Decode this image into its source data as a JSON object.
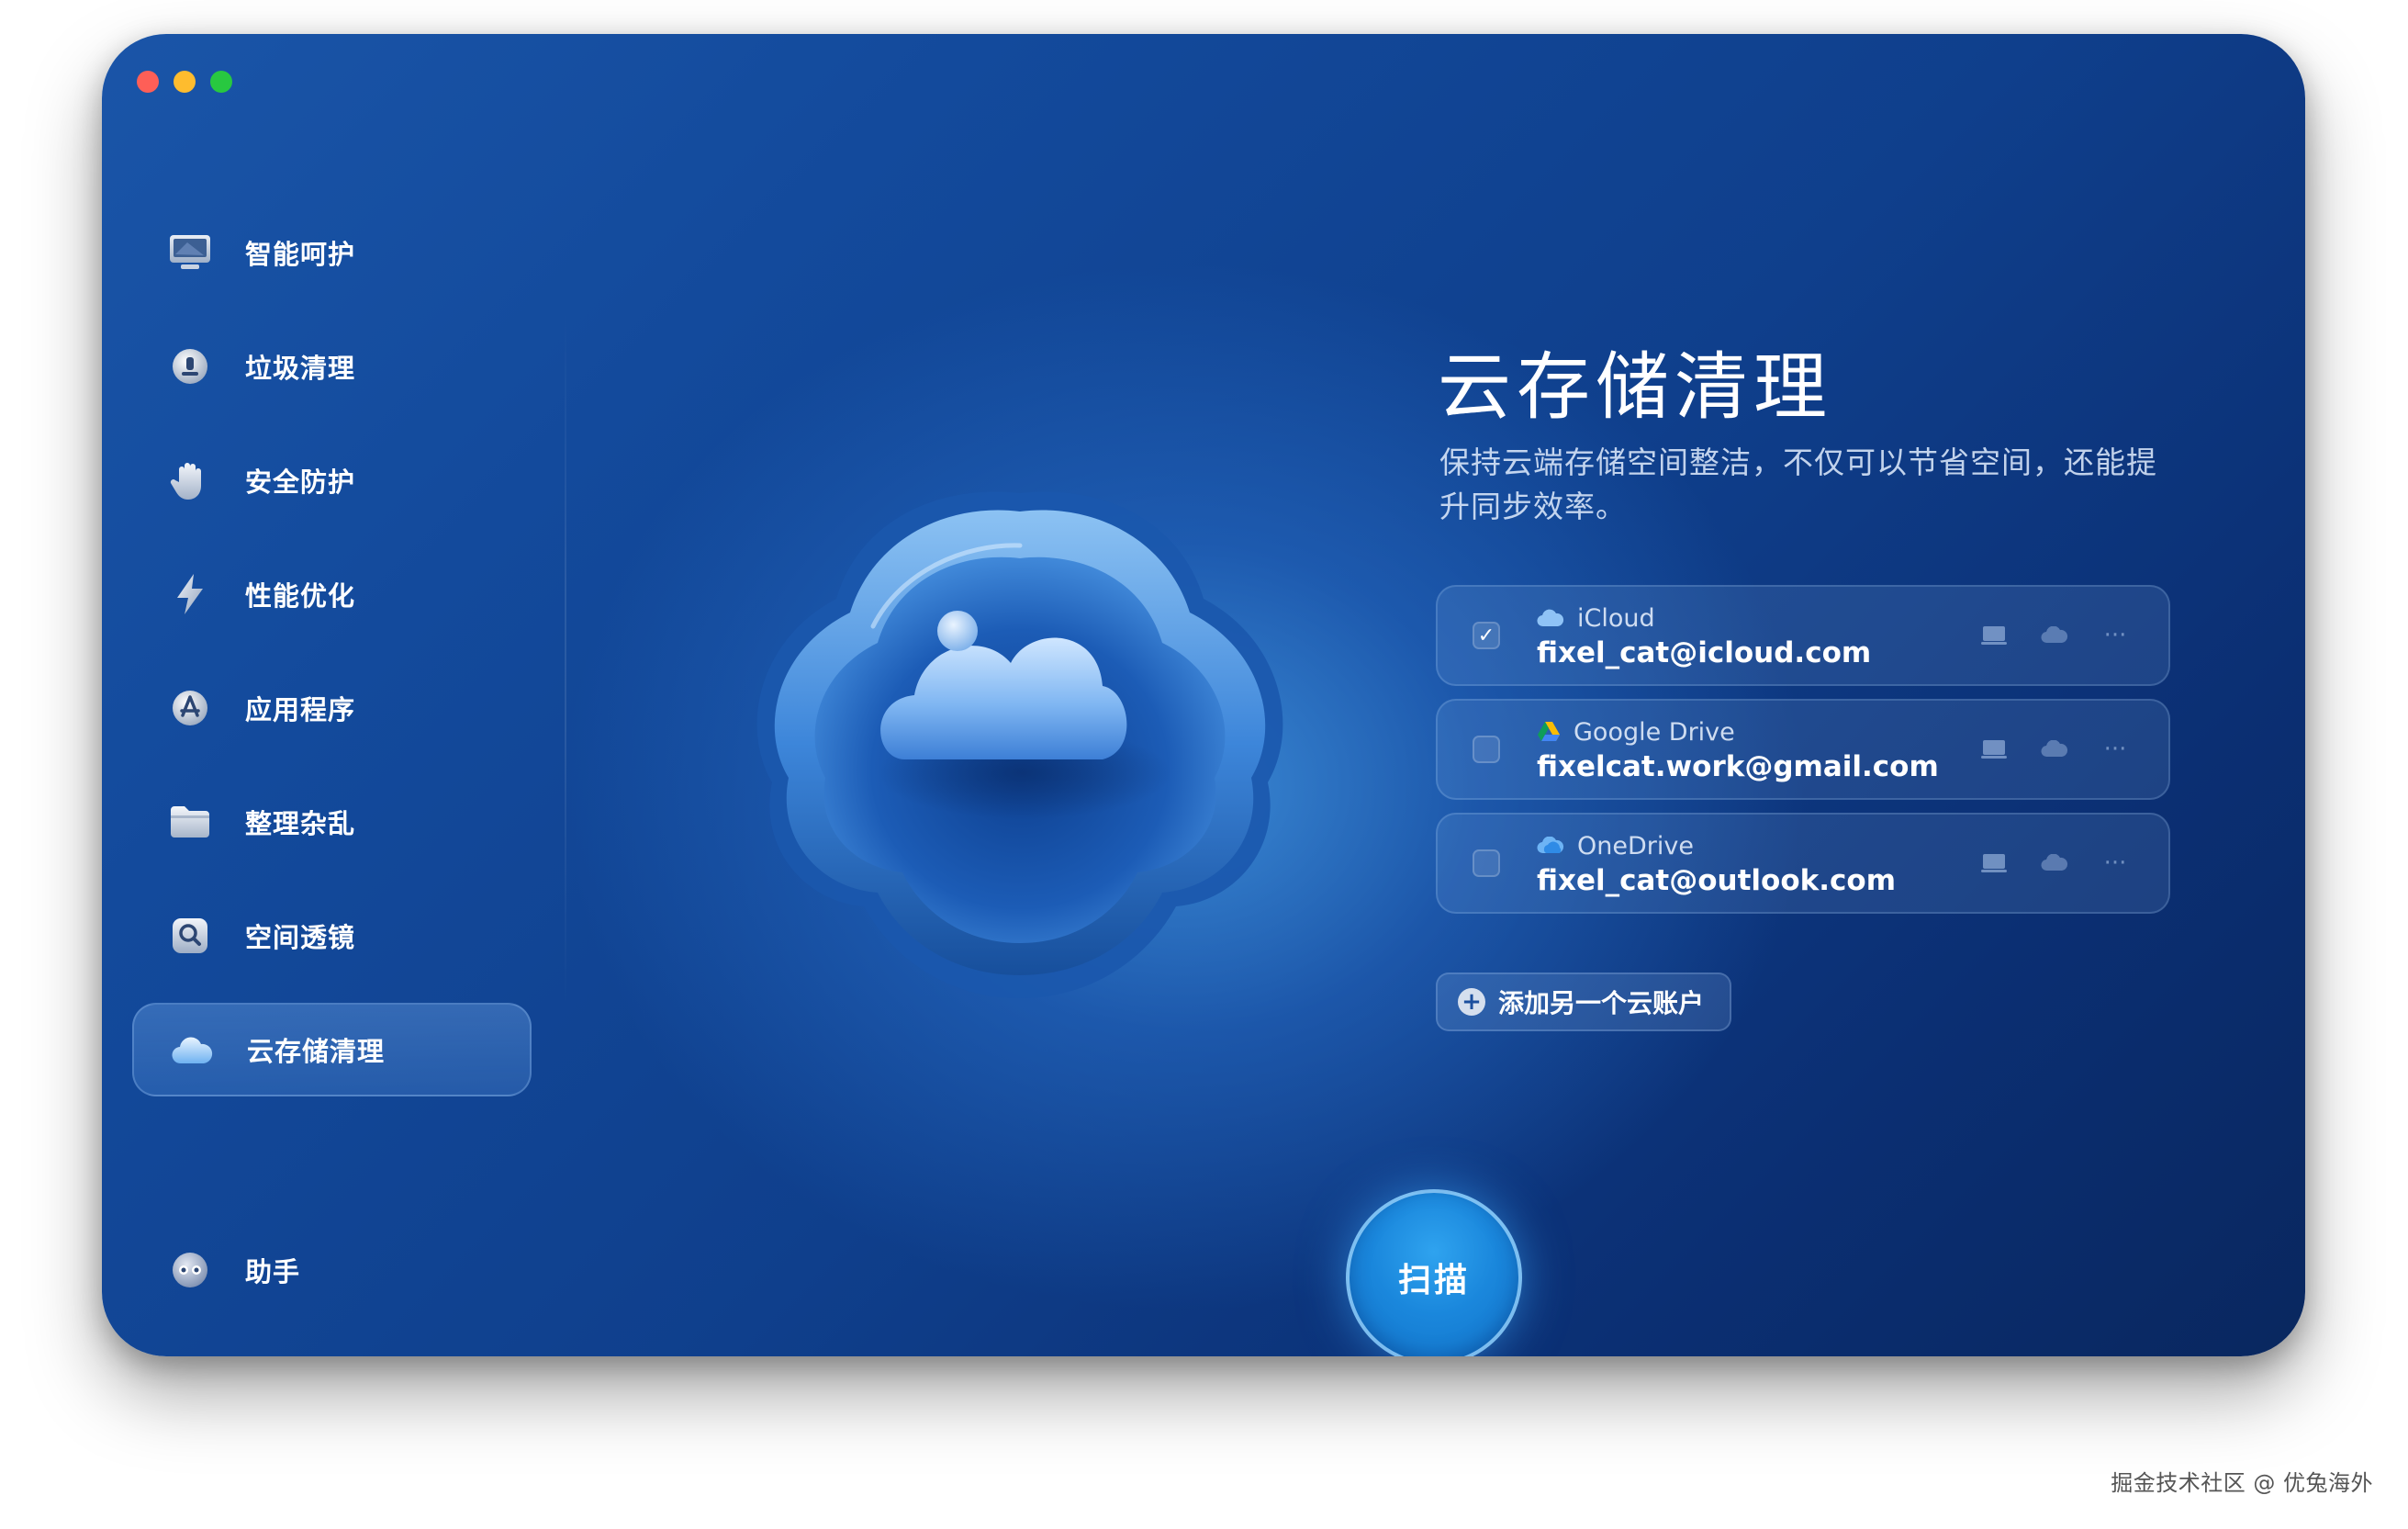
{
  "window": {
    "traffic_lights": [
      "close",
      "minimize",
      "maximize"
    ]
  },
  "sidebar": {
    "items": [
      {
        "label": "智能呵护",
        "icon": "monitor-icon"
      },
      {
        "label": "垃圾清理",
        "icon": "trash-globe-icon"
      },
      {
        "label": "安全防护",
        "icon": "hand-icon"
      },
      {
        "label": "性能优化",
        "icon": "lightning-icon"
      },
      {
        "label": "应用程序",
        "icon": "app-store-icon"
      },
      {
        "label": "整理杂乱",
        "icon": "folder-icon"
      },
      {
        "label": "空间透镜",
        "icon": "lens-icon"
      },
      {
        "label": "云存储清理",
        "icon": "cloud-icon",
        "active": true
      }
    ],
    "assistant_label": "助手"
  },
  "main": {
    "title": "云存储清理",
    "description": "保持云端存储空间整洁，不仅可以节省空间，还能提升同步效率。",
    "accounts": [
      {
        "provider": "iCloud",
        "email": "fixel_cat@icloud.com",
        "checked": true,
        "check_mark": "✓",
        "more": "···"
      },
      {
        "provider": "Google Drive",
        "email": "fixelcat.work@gmail.com",
        "checked": false,
        "check_mark": "",
        "more": "···"
      },
      {
        "provider": "OneDrive",
        "email": "fixel_cat@outlook.com",
        "checked": false,
        "check_mark": "",
        "more": "···"
      }
    ],
    "add_account_label": "添加另一个云账户",
    "add_account_icon": "+",
    "scan_label": "扫描"
  },
  "watermark": "掘金技术社区 @ 优兔海外",
  "colors": {
    "window_bg_dark": "#09275f",
    "window_bg_light": "#1a55a8",
    "accent": "#1a87dc",
    "close": "#fe5f57",
    "minimize": "#febc2e",
    "maximize": "#28c840"
  }
}
